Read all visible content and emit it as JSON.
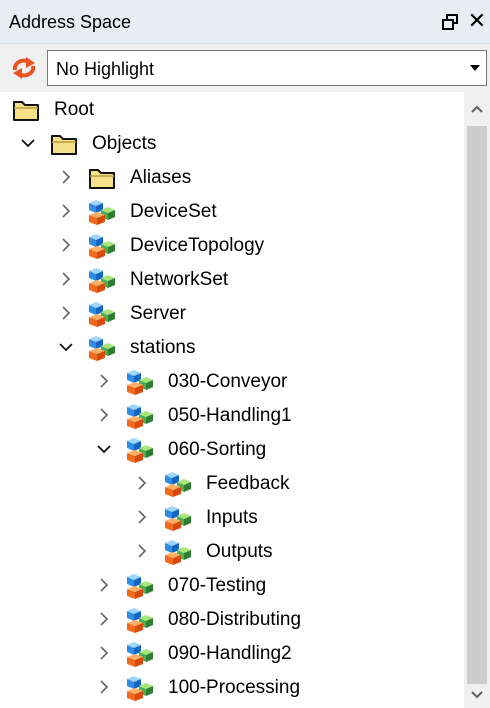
{
  "panel": {
    "title": "Address Space"
  },
  "toolbar": {
    "highlight_value": "No Highlight"
  },
  "tree": [
    {
      "label": "Root",
      "level": 0,
      "toggle": "none",
      "icon": "folder"
    },
    {
      "label": "Objects",
      "level": 1,
      "toggle": "expanded",
      "icon": "folder"
    },
    {
      "label": "Aliases",
      "level": 2,
      "toggle": "collapsed",
      "icon": "folder"
    },
    {
      "label": "DeviceSet",
      "level": 2,
      "toggle": "collapsed",
      "icon": "object"
    },
    {
      "label": "DeviceTopology",
      "level": 2,
      "toggle": "collapsed",
      "icon": "object"
    },
    {
      "label": "NetworkSet",
      "level": 2,
      "toggle": "collapsed",
      "icon": "object"
    },
    {
      "label": "Server",
      "level": 2,
      "toggle": "collapsed",
      "icon": "object"
    },
    {
      "label": "stations",
      "level": 2,
      "toggle": "expanded",
      "icon": "object"
    },
    {
      "label": "030-Conveyor",
      "level": 3,
      "toggle": "collapsed",
      "icon": "object"
    },
    {
      "label": "050-Handling1",
      "level": 3,
      "toggle": "collapsed",
      "icon": "object"
    },
    {
      "label": "060-Sorting",
      "level": 3,
      "toggle": "expanded",
      "icon": "object"
    },
    {
      "label": "Feedback",
      "level": 4,
      "toggle": "collapsed",
      "icon": "object"
    },
    {
      "label": "Inputs",
      "level": 4,
      "toggle": "collapsed",
      "icon": "object"
    },
    {
      "label": "Outputs",
      "level": 4,
      "toggle": "collapsed",
      "icon": "object"
    },
    {
      "label": "070-Testing",
      "level": 3,
      "toggle": "collapsed",
      "icon": "object"
    },
    {
      "label": "080-Distributing",
      "level": 3,
      "toggle": "collapsed",
      "icon": "object"
    },
    {
      "label": "090-Handling2",
      "level": 3,
      "toggle": "collapsed",
      "icon": "object"
    },
    {
      "label": "100-Processing",
      "level": 3,
      "toggle": "collapsed",
      "icon": "object"
    }
  ]
}
